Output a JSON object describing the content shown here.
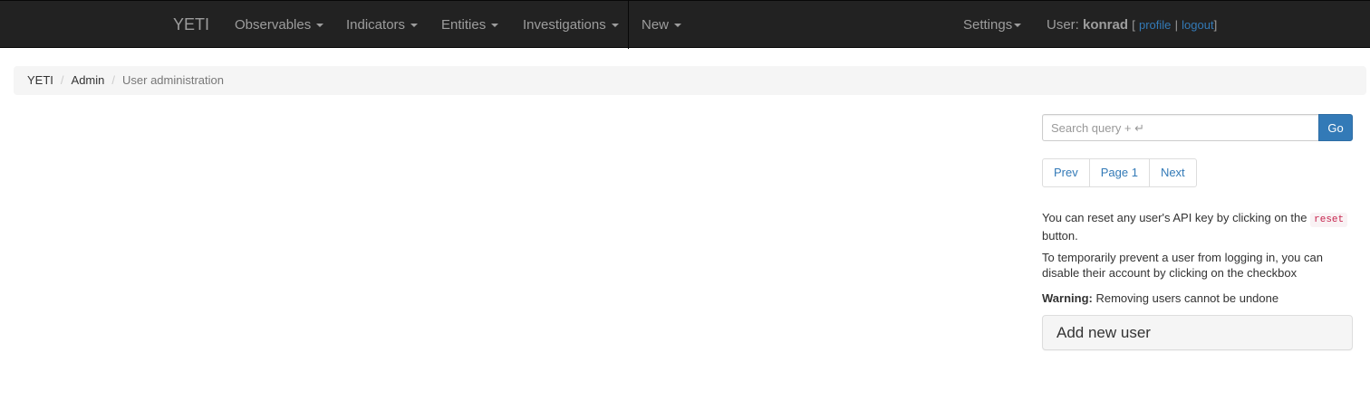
{
  "navbar": {
    "brand": "YETI",
    "menus": [
      {
        "label": "Observables"
      },
      {
        "label": "Indicators"
      },
      {
        "label": "Entities"
      },
      {
        "label": "Investigations"
      },
      {
        "label": "New"
      }
    ],
    "settings_label": "Settings",
    "user": {
      "prefix": "User: ",
      "name": "konrad",
      "open_bracket": "[",
      "profile_label": "profile",
      "separator": "|",
      "logout_label": "logout",
      "close_bracket": "]"
    }
  },
  "breadcrumb": {
    "items": [
      "YETI",
      "Admin"
    ],
    "separator": "/",
    "active": "User administration"
  },
  "search": {
    "placeholder": "Search query + ↵",
    "go_label": "Go"
  },
  "pagination": {
    "prev_label": "Prev",
    "page_label": "Page 1",
    "next_label": "Next"
  },
  "help": {
    "reset_pre": "You can reset any user's API key by clicking on the ",
    "reset_code": "reset",
    "reset_post": " button.",
    "disable_text": "To temporarily prevent a user from logging in, you can disable their account by clicking on the checkbox",
    "warning_label": "Warning:",
    "warning_text": " Removing users cannot be undone"
  },
  "add_user": {
    "title": "Add new user"
  },
  "colors": {
    "navbar_bg": "#222222",
    "nav_text": "#9d9d9d",
    "link": "#337ab7",
    "primary_button": "#337ab7",
    "code_text": "#c7254e"
  }
}
